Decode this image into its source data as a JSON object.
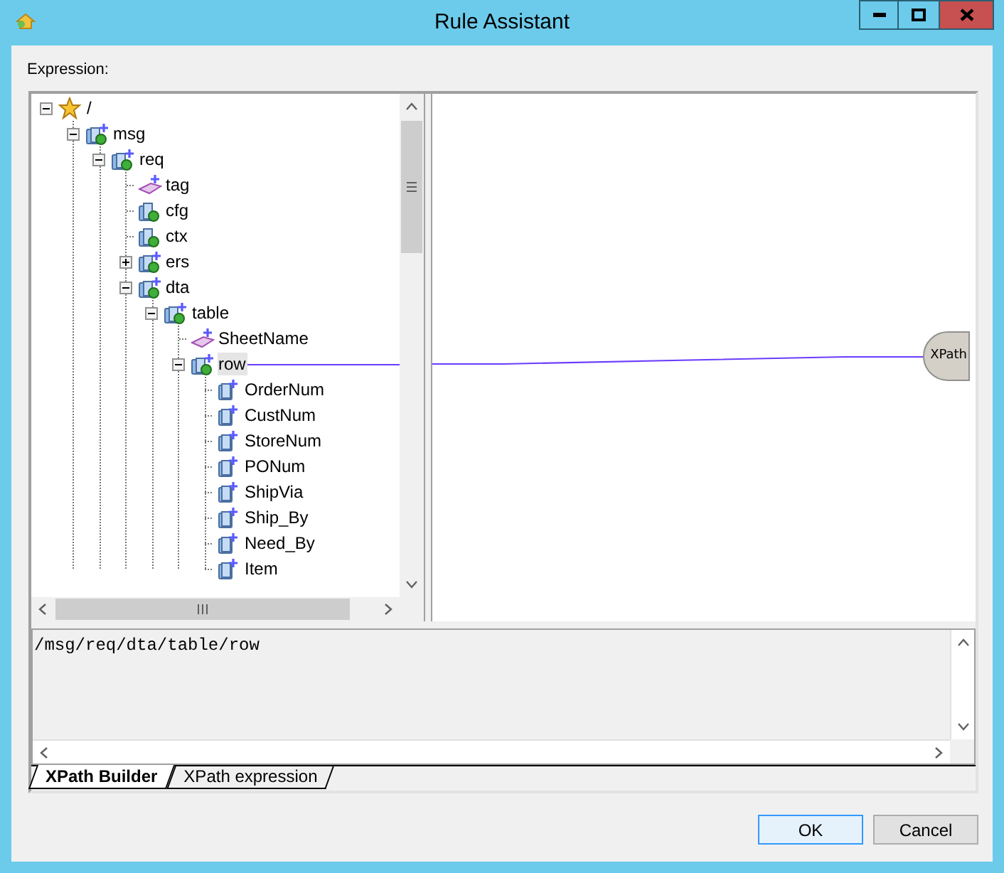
{
  "window": {
    "title": "Rule Assistant"
  },
  "expression_label": "Expression:",
  "tree": [
    {
      "label": "/",
      "kind": "root",
      "expanded": true,
      "selected": false,
      "children": [
        {
          "label": "msg",
          "kind": "group",
          "expanded": true,
          "selected": false,
          "children": [
            {
              "label": "req",
              "kind": "group",
              "expanded": true,
              "selected": false,
              "children": [
                {
                  "label": "tag",
                  "kind": "attribute",
                  "selected": false
                },
                {
                  "label": "cfg",
                  "kind": "container",
                  "selected": false
                },
                {
                  "label": "ctx",
                  "kind": "container",
                  "selected": false
                },
                {
                  "label": "ers",
                  "kind": "group",
                  "expanded": false,
                  "selected": false
                },
                {
                  "label": "dta",
                  "kind": "group",
                  "expanded": true,
                  "selected": false,
                  "children": [
                    {
                      "label": "table",
                      "kind": "group",
                      "expanded": true,
                      "selected": false,
                      "children": [
                        {
                          "label": "SheetName",
                          "kind": "attribute",
                          "selected": false
                        },
                        {
                          "label": "row",
                          "kind": "group",
                          "expanded": true,
                          "selected": true,
                          "children": [
                            {
                              "label": "OrderNum",
                              "kind": "field",
                              "selected": false
                            },
                            {
                              "label": "CustNum",
                              "kind": "field",
                              "selected": false
                            },
                            {
                              "label": "StoreNum",
                              "kind": "field",
                              "selected": false
                            },
                            {
                              "label": "PONum",
                              "kind": "field",
                              "selected": false
                            },
                            {
                              "label": "ShipVia",
                              "kind": "field",
                              "selected": false
                            },
                            {
                              "label": "Ship_By",
                              "kind": "field",
                              "selected": false
                            },
                            {
                              "label": "Need_By",
                              "kind": "field",
                              "selected": false
                            },
                            {
                              "label": "Item",
                              "kind": "field",
                              "selected": false
                            }
                          ]
                        }
                      ]
                    }
                  ]
                }
              ]
            }
          ]
        }
      ]
    }
  ],
  "canvas": {
    "node": {
      "label": "XPath"
    }
  },
  "expression": "/msg/req/dta/table/row",
  "tabs": [
    {
      "label": "XPath Builder",
      "selected": true
    },
    {
      "label": "XPath expression",
      "selected": false
    }
  ],
  "buttons": [
    "OK",
    "Cancel"
  ]
}
